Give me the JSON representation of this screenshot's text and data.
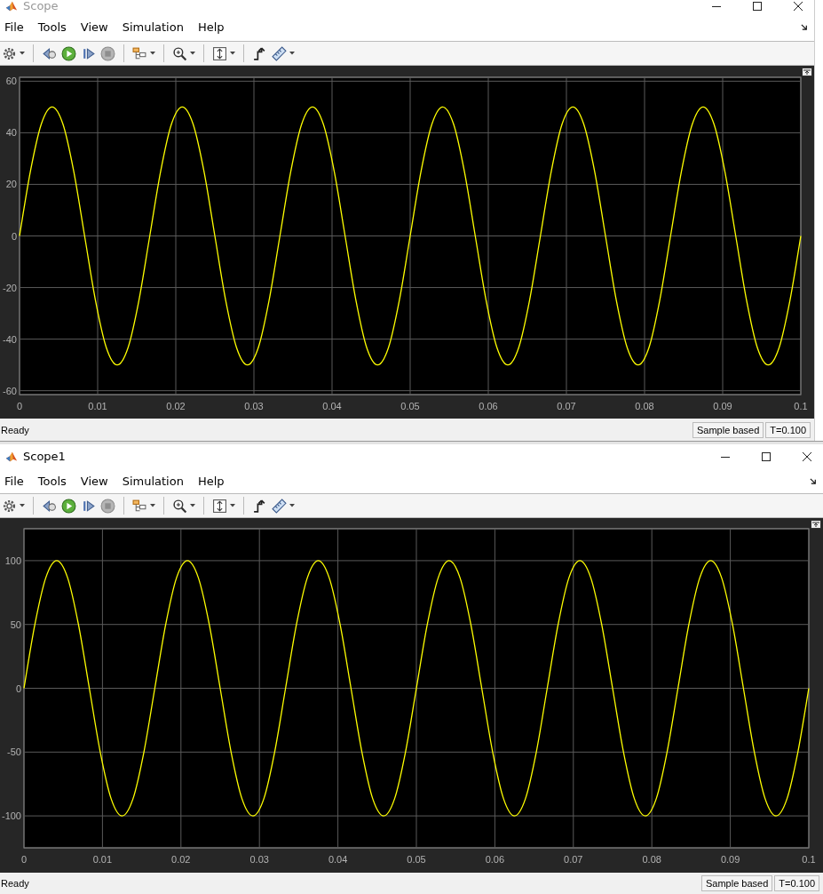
{
  "windows": [
    {
      "title": "Scope",
      "active": false,
      "menu": [
        "File",
        "Tools",
        "View",
        "Simulation",
        "Help"
      ],
      "chart_data": {
        "type": "line",
        "x": [
          0,
          0.00139,
          0.00278,
          0.00417,
          0.00556,
          0.00694,
          0.00833,
          0.00972,
          0.01111,
          0.0125,
          0.01389,
          0.01528,
          0.01667,
          0.01806,
          0.01944,
          0.02083,
          0.02222,
          0.02361,
          0.025,
          0.02639,
          0.02778,
          0.02917,
          0.03056,
          0.03194,
          0.03333,
          0.03472,
          0.03611,
          0.0375,
          0.03889,
          0.04028,
          0.04167,
          0.04306,
          0.04444,
          0.04583,
          0.04722,
          0.04861,
          0.05,
          0.05139,
          0.05278,
          0.05417,
          0.05556,
          0.05694,
          0.05833,
          0.05972,
          0.06111,
          0.0625,
          0.06389,
          0.06528,
          0.06667,
          0.06806,
          0.06944,
          0.07083,
          0.07222,
          0.07361,
          0.075,
          0.07639,
          0.07778,
          0.07917,
          0.08056,
          0.08194,
          0.08333,
          0.08472,
          0.08611,
          0.0875,
          0.08889,
          0.09028,
          0.09167,
          0.09306,
          0.09444,
          0.09583,
          0.09722,
          0.09861,
          0.1
        ],
        "series": [
          {
            "color": "#ffff00",
            "values": [
              0,
              25,
              43.3,
              50,
              43.3,
              25,
              0,
              -25,
              -43.3,
              -50,
              -43.3,
              -25,
              0,
              25,
              43.3,
              50,
              43.3,
              25,
              0,
              -25,
              -43.3,
              -50,
              -43.3,
              -25,
              0,
              25,
              43.3,
              50,
              43.3,
              25,
              0,
              -25,
              -43.3,
              -50,
              -43.3,
              -25,
              0,
              25,
              43.3,
              50,
              43.3,
              25,
              0,
              -25,
              -43.3,
              -50,
              -43.3,
              -25,
              0,
              25,
              43.3,
              50,
              43.3,
              25,
              0,
              -25,
              -43.3,
              -50,
              -43.3,
              -25,
              0,
              25,
              43.3,
              50,
              43.3,
              25,
              0,
              -25,
              -43.3,
              -50,
              -43.3,
              -25,
              0
            ]
          }
        ],
        "xlim": [
          0,
          0.1
        ],
        "ylim": [
          -61.5,
          61.5
        ],
        "xticks": [
          0,
          0.01,
          0.02,
          0.03,
          0.04,
          0.05,
          0.06,
          0.07,
          0.08,
          0.09,
          0.1
        ],
        "yticks": [
          -60,
          -40,
          -20,
          0,
          20,
          40,
          60
        ],
        "grid": true
      },
      "status": {
        "text": "Ready",
        "cells": [
          "Sample based",
          "T=0.100"
        ]
      }
    },
    {
      "title": "Scope1",
      "active": true,
      "menu": [
        "File",
        "Tools",
        "View",
        "Simulation",
        "Help"
      ],
      "chart_data": {
        "type": "line",
        "x": [
          0,
          0.00139,
          0.00278,
          0.00417,
          0.00556,
          0.00694,
          0.00833,
          0.00972,
          0.01111,
          0.0125,
          0.01389,
          0.01528,
          0.01667,
          0.01806,
          0.01944,
          0.02083,
          0.02222,
          0.02361,
          0.025,
          0.02639,
          0.02778,
          0.02917,
          0.03056,
          0.03194,
          0.03333,
          0.03472,
          0.03611,
          0.0375,
          0.03889,
          0.04028,
          0.04167,
          0.04306,
          0.04444,
          0.04583,
          0.04722,
          0.04861,
          0.05,
          0.05139,
          0.05278,
          0.05417,
          0.05556,
          0.05694,
          0.05833,
          0.05972,
          0.06111,
          0.0625,
          0.06389,
          0.06528,
          0.06667,
          0.06806,
          0.06944,
          0.07083,
          0.07222,
          0.07361,
          0.075,
          0.07639,
          0.07778,
          0.07917,
          0.08056,
          0.08194,
          0.08333,
          0.08472,
          0.08611,
          0.0875,
          0.08889,
          0.09028,
          0.09167,
          0.09306,
          0.09444,
          0.09583,
          0.09722,
          0.09861,
          0.1
        ],
        "series": [
          {
            "color": "#ffff00",
            "values": [
              0,
              50,
              86.6,
              100,
              86.6,
              50,
              0,
              -50,
              -86.6,
              -100,
              -86.6,
              -50,
              0,
              50,
              86.6,
              100,
              86.6,
              50,
              0,
              -50,
              -86.6,
              -100,
              -86.6,
              -50,
              0,
              50,
              86.6,
              100,
              86.6,
              50,
              0,
              -50,
              -86.6,
              -100,
              -86.6,
              -50,
              0,
              50,
              86.6,
              100,
              86.6,
              50,
              0,
              -50,
              -86.6,
              -100,
              -86.6,
              -50,
              0,
              50,
              86.6,
              100,
              86.6,
              50,
              0,
              -50,
              -86.6,
              -100,
              -86.6,
              -50,
              0,
              50,
              86.6,
              100,
              86.6,
              50,
              0,
              -50,
              -86.6,
              -100,
              -86.6,
              -50,
              0
            ]
          }
        ],
        "xlim": [
          0,
          0.1
        ],
        "ylim": [
          -125,
          125
        ],
        "xticks": [
          0,
          0.01,
          0.02,
          0.03,
          0.04,
          0.05,
          0.06,
          0.07,
          0.08,
          0.09,
          0.1
        ],
        "yticks": [
          -100,
          -50,
          0,
          50,
          100
        ],
        "grid": true
      },
      "status": {
        "text": "Ready",
        "cells": [
          "Sample based",
          "T=0.100"
        ]
      }
    }
  ]
}
